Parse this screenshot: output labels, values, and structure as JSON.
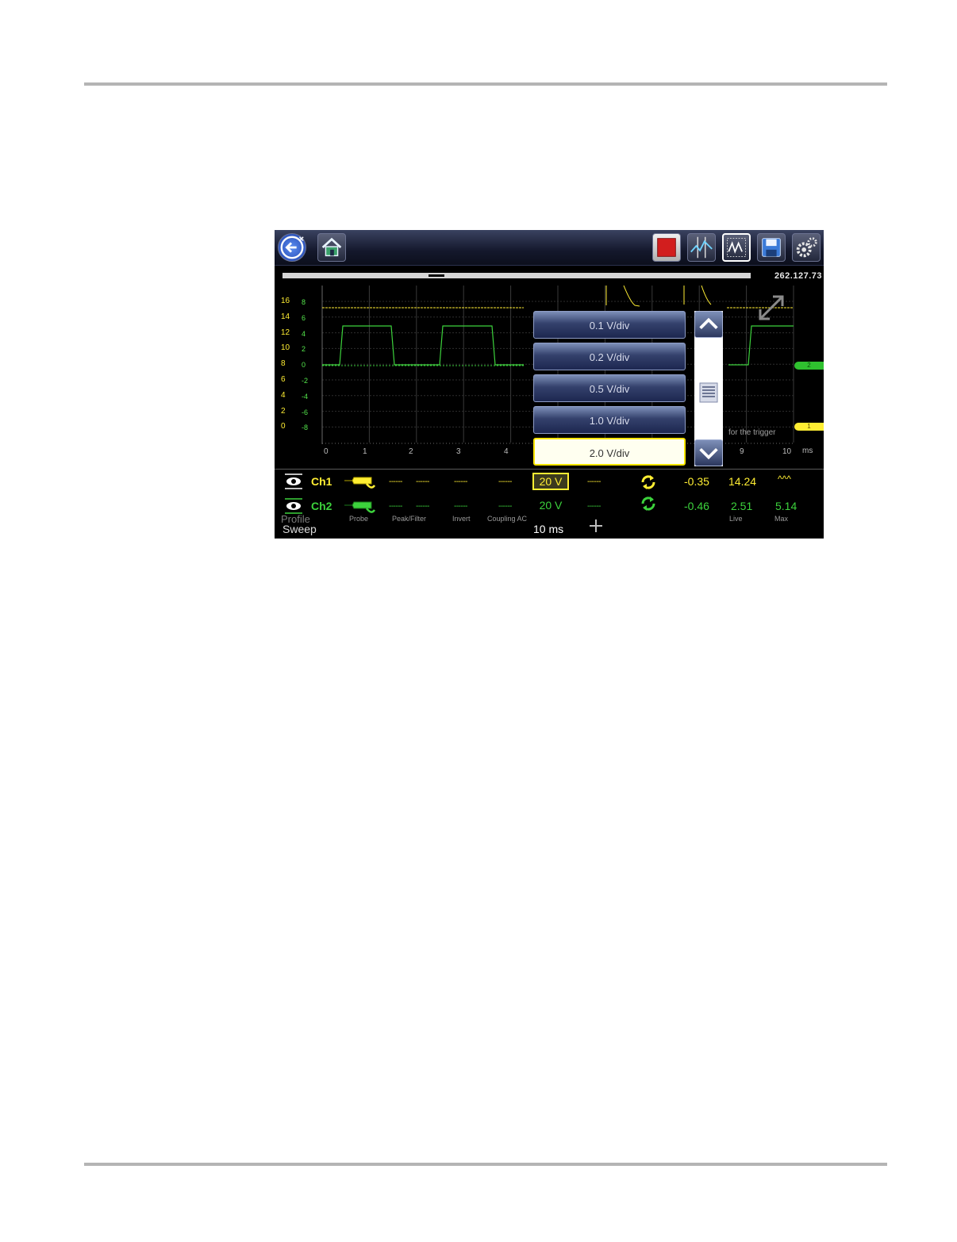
{
  "toolbar": {
    "buttons": [
      "back-icon",
      "home-icon",
      "stop-icon",
      "cursors-icon",
      "scope-trace-icon",
      "save-icon",
      "settings-icon"
    ]
  },
  "position_readout": "262.127.73",
  "plot": {
    "ch1_ticks": [
      "16",
      "14",
      "12",
      "10",
      "8",
      "6",
      "4",
      "2",
      "0"
    ],
    "ch2_ticks": [
      "8",
      "6",
      "4",
      "2",
      "0",
      "-2",
      "-4",
      "-6",
      "-8"
    ],
    "x_ticks": [
      "0",
      "1",
      "2",
      "3",
      "4",
      "9",
      "10"
    ],
    "x_unit": "ms",
    "trigger_hint": "for the trigger",
    "marker_ch2": "2",
    "marker_ch1": "1",
    "colors": {
      "ch1": "#ffee33",
      "ch2": "#3cd23c"
    }
  },
  "columns": {
    "profile": "Profile",
    "probe": "Probe",
    "peak_filter": "Peak/Filter",
    "invert": "Invert",
    "coupling": "Coupling AC",
    "live": "Live",
    "max": "Max"
  },
  "dropdown": {
    "options": [
      "0.1 V/div",
      "0.2 V/div",
      "0.5 V/div",
      "1.0 V/div",
      "2.0 V/div"
    ],
    "selected_index": 4
  },
  "channels": [
    {
      "name": "Ch1",
      "dash": "------",
      "scale": "20 V",
      "min": "-0.35",
      "live": "14.24",
      "max": "^^^"
    },
    {
      "name": "Ch2",
      "dash": "------",
      "scale": "20 V",
      "min": "-0.46",
      "live": "2.51",
      "max": "5.14"
    }
  ],
  "sweep": {
    "label": "Sweep",
    "value": "10 ms"
  }
}
